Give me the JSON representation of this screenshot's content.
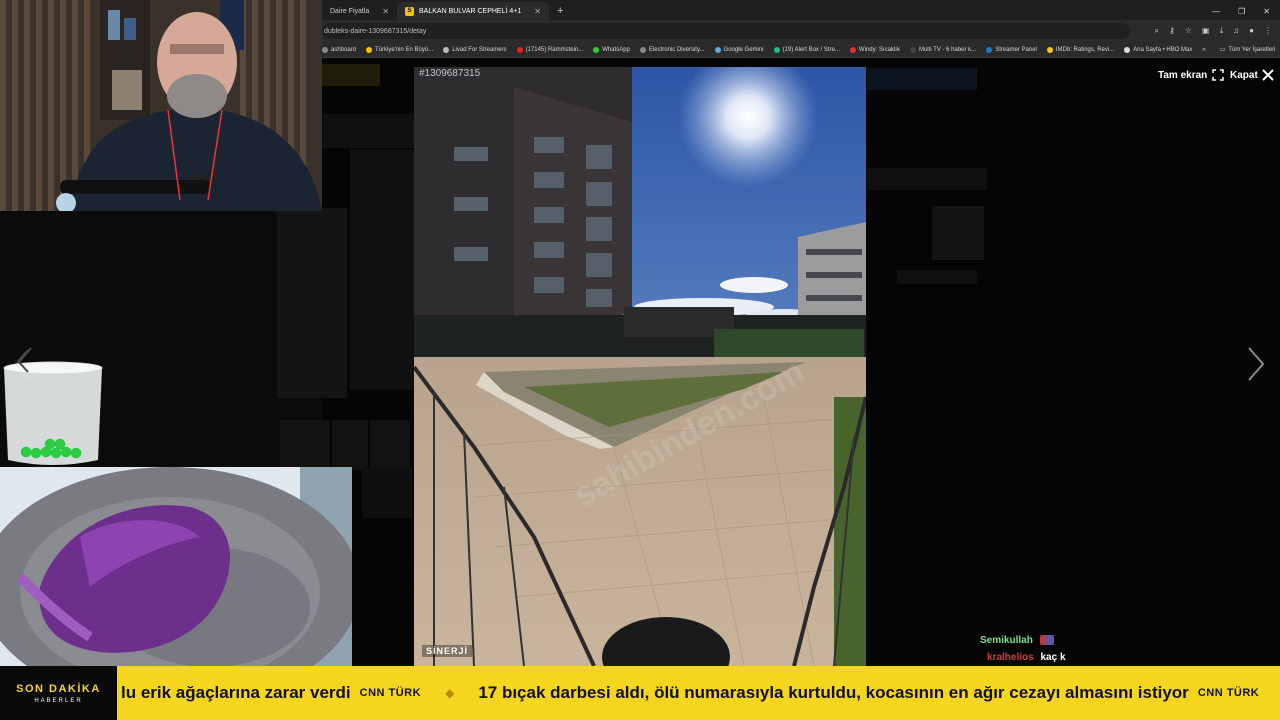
{
  "browser": {
    "tabs": [
      {
        "label": "Daire Fiyatla",
        "active": false
      },
      {
        "label": "BALKAN BULVAR CEPHELİ 4+1",
        "active": true
      }
    ],
    "url": "dubleks-daire-1309687315/detay",
    "bookmarks": [
      {
        "label": "ashboard",
        "color": "#8a8a8a"
      },
      {
        "label": "Türkiye'nin En Büyü...",
        "color": "#f2c500"
      },
      {
        "label": "Livad For Streamers",
        "color": "#bbbbbb"
      },
      {
        "label": "(17145) Rammstein...",
        "color": "#e22"
      },
      {
        "label": "WhatsApp",
        "color": "#3c3"
      },
      {
        "label": "Electronic Diversity...",
        "color": "#888"
      },
      {
        "label": "Google Gemini",
        "color": "#6ad"
      },
      {
        "label": "(19) Alert Box / Stre...",
        "color": "#2b8"
      },
      {
        "label": "Windy: Sıcaklık",
        "color": "#d33"
      },
      {
        "label": "Multi TV - 6 haber k...",
        "color": "#444"
      },
      {
        "label": "Streamer Panel",
        "color": "#27c"
      },
      {
        "label": "IMDb: Ratings, Revi...",
        "color": "#f5c518"
      },
      {
        "label": "Ana Sayfa • HBO Max",
        "color": "#ddd"
      }
    ],
    "bookmarks_more": "»",
    "bookmarks_folder": "Tüm Yer İşaretleri"
  },
  "lightbox": {
    "listing_number": "#1309687315",
    "fullscreen_label": "Tam ekran",
    "close_label": "Kapat",
    "brand": "SİNERJİ",
    "watermark": "sahibinden.com"
  },
  "chat": [
    {
      "user": "Semikullah",
      "message": "",
      "user_color": "#76e28c"
    },
    {
      "user": "kralhelios",
      "message": "kaç k",
      "user_color": "#d23b3b"
    }
  ],
  "ticker": {
    "badge_title": "SON DAKİKA",
    "badge_sub": "HABERLER",
    "items": [
      {
        "headline": "lu erik ağaçlarına zarar verdi",
        "source": "CNN TÜRK"
      },
      {
        "headline": "17 bıçak darbesi aldı, ölü numarasıyla kurtuldu, kocasının en ağır cezayı almasını istiyor",
        "source": "CNN TÜRK"
      }
    ],
    "separator": "◆"
  },
  "colors": {
    "ticker_bg": "#f5d51d",
    "ticker_badge_bg": "#0a0a0a",
    "chat_user1": "#76e28c",
    "chat_user2": "#d23b3b"
  }
}
